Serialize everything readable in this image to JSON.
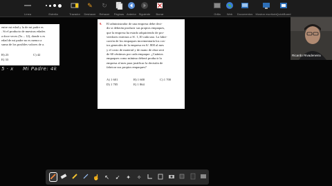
{
  "toolbar": {
    "groups": [
      {
        "label": "Línea",
        "icon": "line-icon"
      },
      {
        "label": "Estrella",
        "icon": "star-icon"
      },
      {
        "label": "Trazador",
        "icon": "highlighter-icon"
      },
      {
        "label": "Deshacer",
        "icon": "undo-icon"
      },
      {
        "label": "Rehacer",
        "icon": "redo-icon"
      },
      {
        "label": "Páginas",
        "icon": "pages-icon"
      },
      {
        "label": "Anterior",
        "icon": "previous-icon"
      },
      {
        "label": "Siguiente",
        "icon": "next-icon"
      },
      {
        "label": "Borrar",
        "icon": "clear-icon"
      },
      {
        "label": "Grilla",
        "icon": "grid-icon"
      },
      {
        "label": "Web",
        "icon": "web-icon"
      },
      {
        "label": "Documentos",
        "icon": "documents-icon"
      },
      {
        "label": "Mostrar escritorio",
        "icon": "desktop-icon"
      },
      {
        "label": "QuickBoard",
        "icon": "quickboard-icon"
      }
    ]
  },
  "left_page": {
    "lines": [
      "entre mi edad y la de mi padre es",
      ". Si el producto de nuestras edades",
      "a doce veces (5x – 12), donde x es",
      "edad de mi padre no es menor a",
      "suma de los posibles valores de a."
    ],
    "options": [
      {
        "key": "B)",
        "value": "23"
      },
      {
        "key": "C)",
        "value": "42"
      },
      {
        "key": "E)",
        "value": "33"
      }
    ]
  },
  "right_page": {
    "number": "9.",
    "lines": [
      "El administrador de una empresa debe deci-",
      "dir si deberán producir sus propios empaques,",
      "que la empresa ha estado adquiriendo de pro-",
      "veedores externos a S/. 1,10 cada uno. La fabri-",
      "cación de los empaques incrementaría los cos-",
      "tos generales de la empresa en S/. 800 al mes",
      "y el costo de material y de mano de obra será",
      "de 60 céntimos por cada empaque. ¿Cuántos",
      "empaques como mínimo deberá producir la",
      "empresa al mes para justificar la decisión de",
      "fabricar sus propios empaques?"
    ],
    "options": [
      {
        "key": "A)",
        "value": "1 601"
      },
      {
        "key": "B)",
        "value": "1 600"
      },
      {
        "key": "C)",
        "value": "1 700"
      },
      {
        "key": "D)",
        "value": "1 705"
      },
      {
        "key": "E)",
        "value": "1 864"
      }
    ]
  },
  "handwriting": {
    "left_mark": "5 · x",
    "note": "Mi Padre: 4k"
  },
  "video": {
    "name": "Ricardo Rivadeneira"
  },
  "bottombar": {
    "tools": [
      {
        "icon": "pen-icon",
        "active": true
      },
      {
        "icon": "eraser-icon",
        "active": false
      },
      {
        "icon": "marker-icon",
        "active": false
      },
      {
        "icon": "brush-icon",
        "active": false
      },
      {
        "icon": "hand-pointer-icon",
        "active": false
      },
      {
        "icon": "select-icon",
        "active": false
      },
      {
        "icon": "laser-icon",
        "active": false
      },
      {
        "icon": "shapes-icon",
        "active": false
      },
      {
        "icon": "sparkle-icon",
        "active": false
      },
      {
        "icon": "angle-icon",
        "active": false
      },
      {
        "icon": "paste-icon",
        "active": false
      },
      {
        "icon": "camera-icon",
        "active": false
      },
      {
        "icon": "fill-icon",
        "active": false
      },
      {
        "icon": "layer-icon",
        "active": false
      },
      {
        "icon": "close-board-icon",
        "active": false
      }
    ]
  }
}
